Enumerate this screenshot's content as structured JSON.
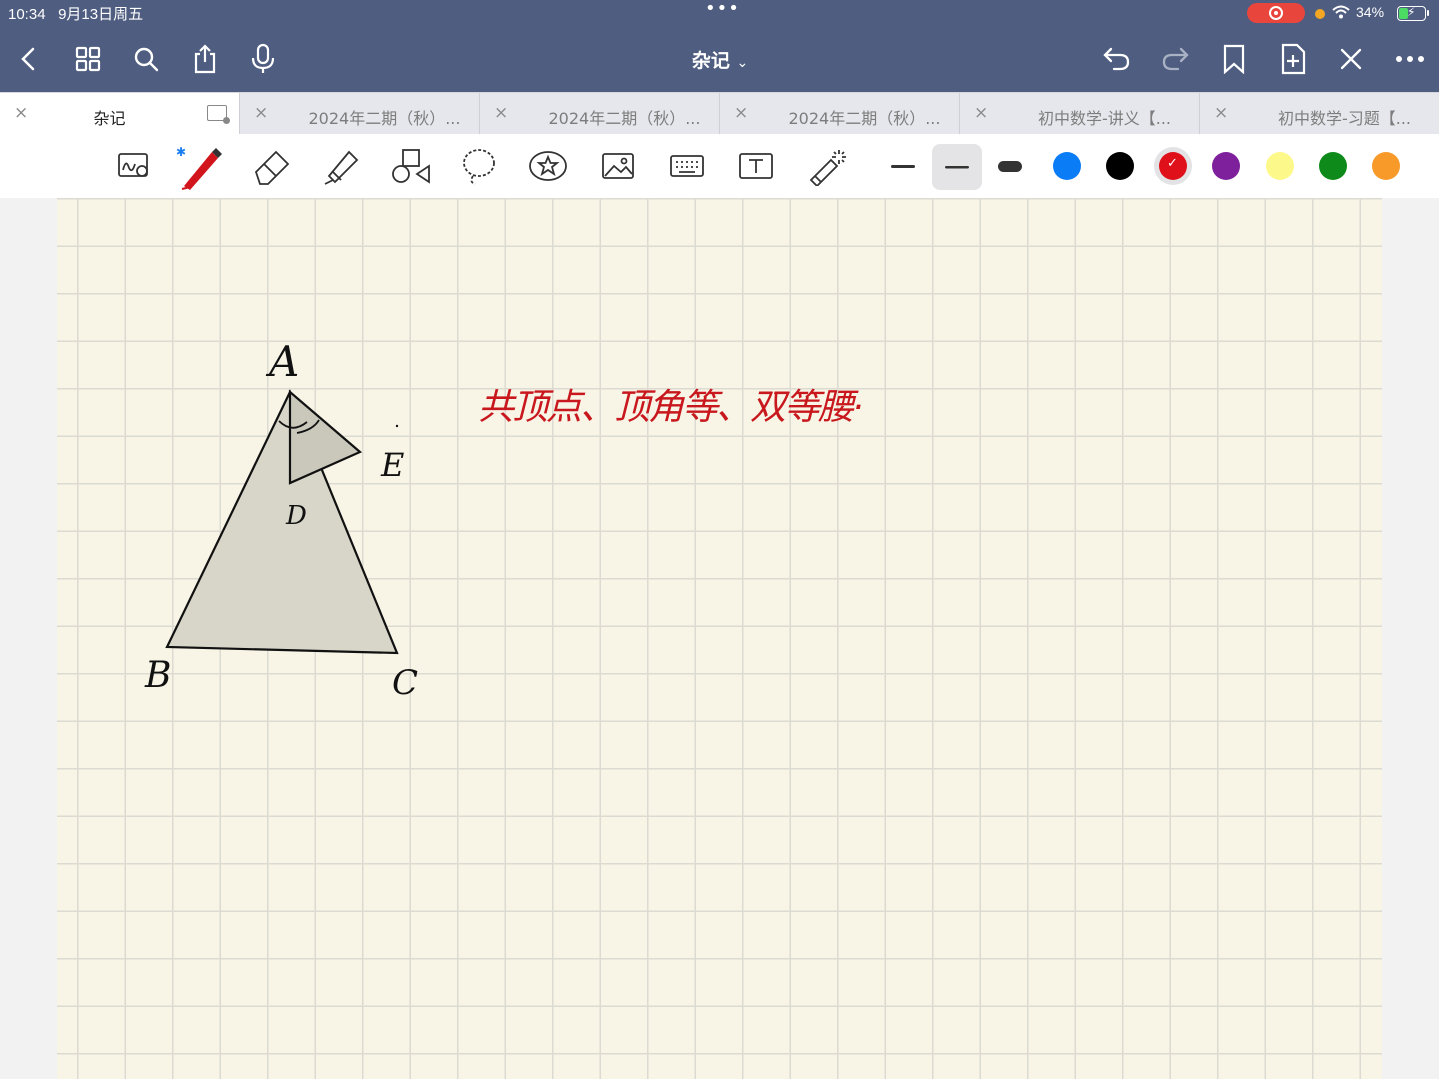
{
  "status": {
    "time": "10:34",
    "date": "9月13日周五",
    "dots": "•••",
    "battery": "34%"
  },
  "nav": {
    "title": "杂记",
    "title_chevron": "⌄"
  },
  "tabs": [
    {
      "label": "杂记",
      "active": true
    },
    {
      "label": "2024年二期（秋）..."
    },
    {
      "label": "2024年二期（秋）..."
    },
    {
      "label": "2024年二期（秋）..."
    },
    {
      "label": "初中数学-讲义【..."
    },
    {
      "label": "初中数学-习题【..."
    }
  ],
  "tab_close": "×",
  "colors": [
    "#0a7cf5",
    "#000000",
    "#e0101a",
    "#7e1f9c",
    "#fdf88a",
    "#0d8a19",
    "#f79a2a"
  ],
  "selected_color": "#e0101a",
  "note": {
    "labels": {
      "A": "A",
      "B": "B",
      "C": "C",
      "D": "D",
      "E": "E"
    },
    "red_text": "共顶点、顶角等、双等腰·"
  }
}
